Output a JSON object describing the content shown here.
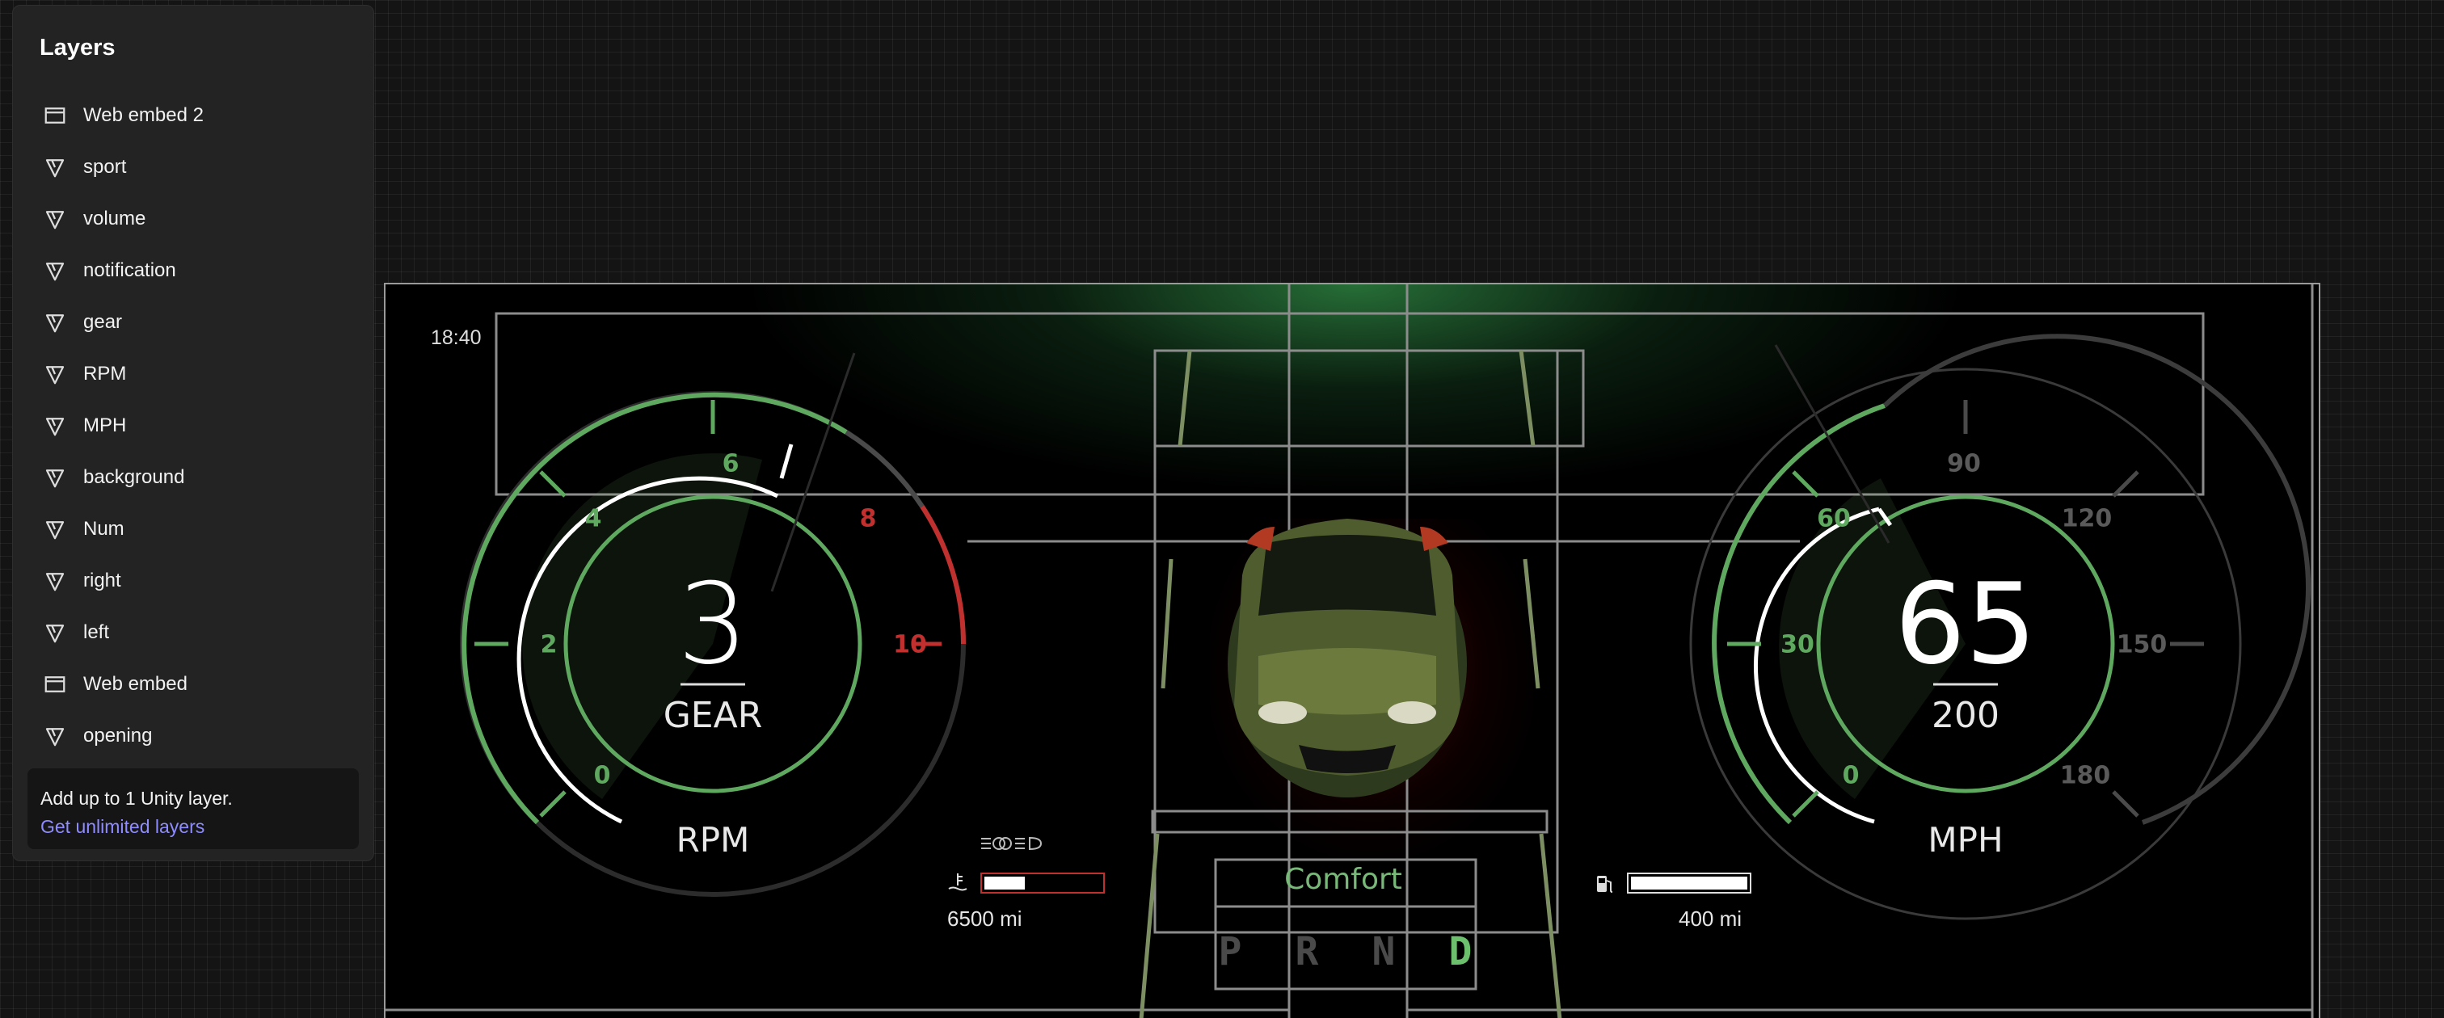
{
  "layers_panel": {
    "title": "Layers",
    "items": [
      {
        "label": "Web embed 2",
        "icon": "window-icon"
      },
      {
        "label": "sport",
        "icon": "component-icon"
      },
      {
        "label": "volume",
        "icon": "component-icon"
      },
      {
        "label": "notification",
        "icon": "component-icon"
      },
      {
        "label": "gear",
        "icon": "component-icon"
      },
      {
        "label": "RPM",
        "icon": "component-icon"
      },
      {
        "label": "MPH",
        "icon": "component-icon"
      },
      {
        "label": "background",
        "icon": "component-icon"
      },
      {
        "label": "Num",
        "icon": "component-icon"
      },
      {
        "label": "right",
        "icon": "component-icon"
      },
      {
        "label": "left",
        "icon": "component-icon"
      },
      {
        "label": "Web embed",
        "icon": "window-icon"
      },
      {
        "label": "opening",
        "icon": "component-icon"
      }
    ],
    "upgrade_text": "Add up to 1 Unity layer.",
    "upgrade_link": "Get unlimited layers"
  },
  "dashboard": {
    "clock": "18:40",
    "rpm_gauge": {
      "gear_value": "3",
      "gear_label": "GEAR",
      "label": "RPM",
      "ticks": [
        "0",
        "2",
        "4",
        "6",
        "8",
        "10"
      ],
      "needle_value": 6.5,
      "redline_start": 8
    },
    "speed_gauge": {
      "speed_value": "65",
      "max_value": "200",
      "label": "MPH",
      "ticks": [
        "0",
        "30",
        "60",
        "90",
        "120",
        "150",
        "180"
      ],
      "needle_value": 65
    },
    "odometer": "6500 mi",
    "range": "400 mi",
    "drive_mode": "Comfort",
    "gear_positions": [
      "P",
      "R",
      "N",
      "D"
    ],
    "active_gear": "D",
    "temperature_level": 0.35,
    "fuel_level": 1.0,
    "colors": {
      "accent_green": "#5fa85f",
      "redline": "#c0302f",
      "background": "#000000"
    }
  }
}
